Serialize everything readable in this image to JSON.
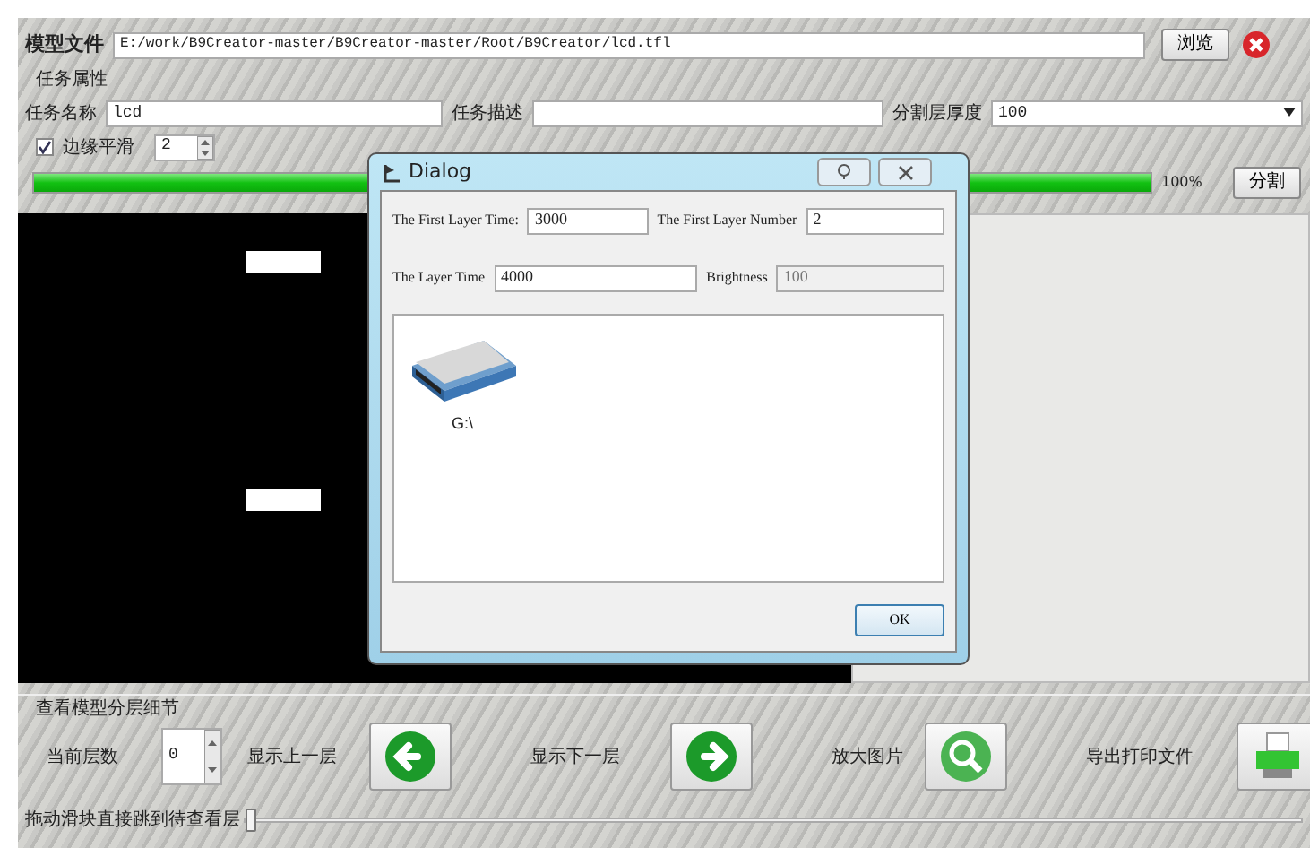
{
  "model_file": {
    "label": "模型文件",
    "path": "E:/work/B9Creator-master/B9Creator-master/Root/B9Creator/lcd.tfl",
    "browse_button": "浏览"
  },
  "task_properties": {
    "title": "任务属性",
    "name_label": "任务名称",
    "name_value": "lcd",
    "description_label": "任务描述",
    "thickness_label": "分割层厚度",
    "thickness_value": "100"
  },
  "edge_smoothing": {
    "label": "边缘平滑",
    "checked": true,
    "value": "2"
  },
  "progress": {
    "level": 1,
    "reading": "100%",
    "split_button": "分割"
  },
  "dialog": {
    "title": "Dialog",
    "fields": [
      {
        "label": "The First Layer Time:",
        "value": "3000",
        "disabled": false
      },
      {
        "label": "The First Layer Number",
        "value": "2",
        "disabled": false
      },
      {
        "label": "The Layer Time",
        "value": "4000",
        "disabled": false
      },
      {
        "label": "Brightness",
        "value": "100",
        "disabled": true
      }
    ],
    "drives": [
      {
        "label": "G:\\"
      }
    ],
    "ok_button": "OK"
  },
  "layer_view": {
    "title": "查看模型分层细节",
    "current_layer_label": "当前层数",
    "current_layer": "0",
    "actions": [
      {
        "label": "显示上一层",
        "kind": "prev"
      },
      {
        "label": "显示下一层",
        "kind": "next"
      },
      {
        "label": "放大图片",
        "kind": "zoom"
      },
      {
        "label": "导出打印文件",
        "kind": "export"
      }
    ],
    "slider": {
      "label": "拖动滑块直接跳到待查看层",
      "level": 0
    }
  }
}
